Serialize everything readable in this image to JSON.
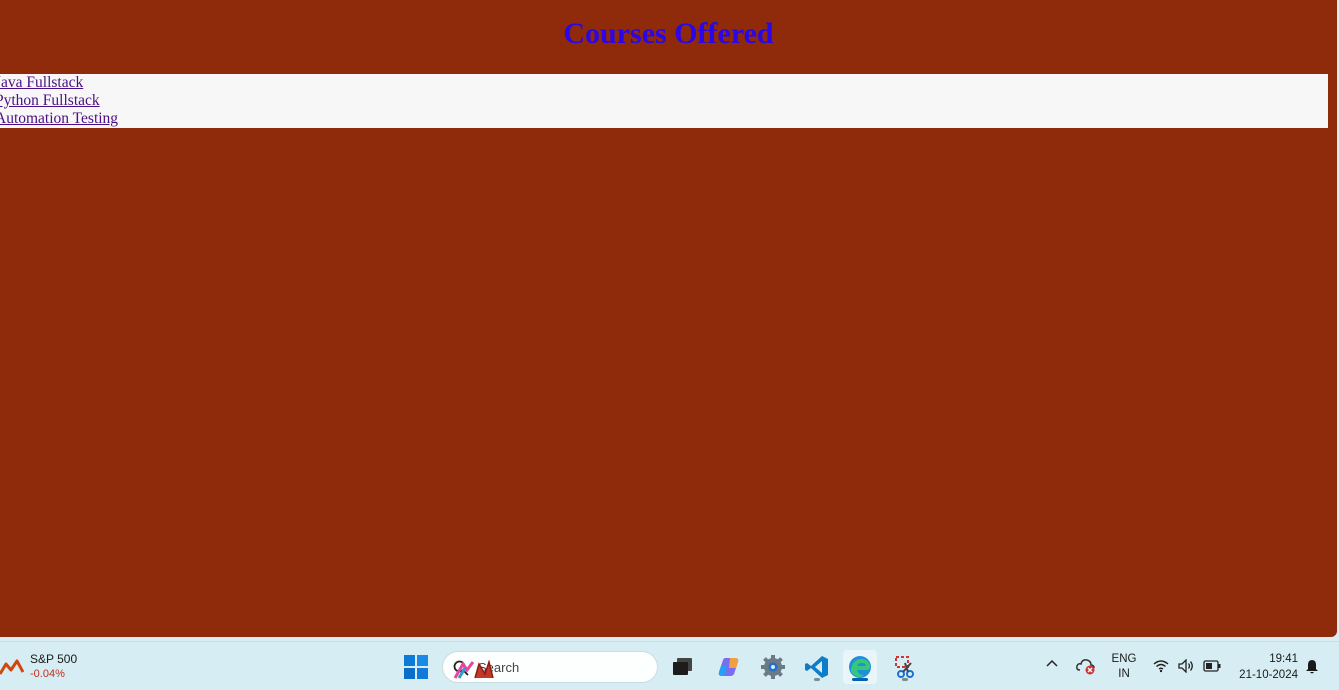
{
  "page": {
    "heading": "Courses Offered",
    "courses": [
      {
        "label": "Java Fullstack"
      },
      {
        "label": "Python Fullstack"
      },
      {
        "label": "Automation Testing"
      }
    ],
    "colors": {
      "background": "#8f2a0b",
      "heading": "#2a06e8",
      "list_background": "#f7f7f7",
      "link": "#4b0f86"
    }
  },
  "taskbar": {
    "widget": {
      "title": "S&P 500",
      "change": "-0.04%",
      "icon": "stock-chart-icon"
    },
    "search": {
      "placeholder": "Search"
    },
    "apps": [
      {
        "name": "start-button",
        "icon": "windows-logo-icon"
      },
      {
        "name": "task-view-button",
        "icon": "task-view-icon"
      },
      {
        "name": "copilot-button",
        "icon": "copilot-icon"
      },
      {
        "name": "settings-app",
        "icon": "gear-icon"
      },
      {
        "name": "vscode-app",
        "icon": "vscode-icon"
      },
      {
        "name": "edge-app",
        "icon": "edge-icon"
      },
      {
        "name": "snipping-tool-app",
        "icon": "snipping-tool-icon"
      }
    ],
    "tray": {
      "language_line1": "ENG",
      "language_line2": "IN",
      "time": "19:41",
      "date": "21-10-2024"
    }
  }
}
